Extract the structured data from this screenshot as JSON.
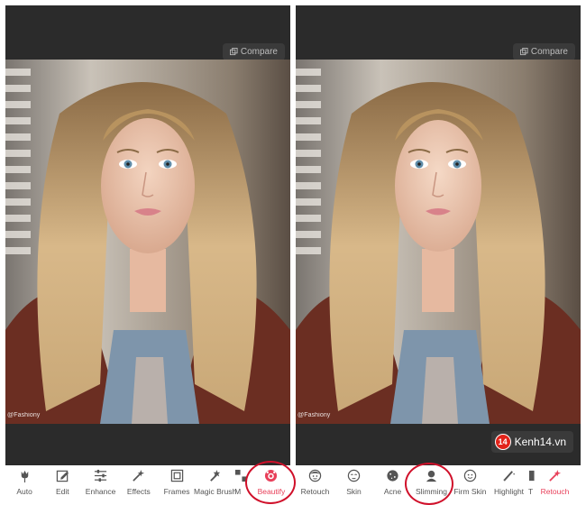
{
  "compare_label": "Compare",
  "watermark": "@Fashiony",
  "site_badge": {
    "logo": "14",
    "text": "Kenh14.vn"
  },
  "left_toolbar": [
    {
      "label": "Auto",
      "icon": "tulip-icon"
    },
    {
      "label": "Edit",
      "icon": "edit-icon"
    },
    {
      "label": "Enhance",
      "icon": "sliders-icon"
    },
    {
      "label": "Effects",
      "icon": "magic-wand-icon"
    },
    {
      "label": "Frames",
      "icon": "frame-icon"
    },
    {
      "label": "Magic Brush",
      "icon": "magic-brush-icon"
    },
    {
      "label": "M",
      "icon": "mosaic-icon"
    },
    {
      "label": "Beautify",
      "icon": "beautify-face-icon",
      "active": true
    }
  ],
  "right_toolbar": [
    {
      "label": "Retouch",
      "icon": "face-retouch-icon"
    },
    {
      "label": "Skin",
      "icon": "skin-icon"
    },
    {
      "label": "Acne",
      "icon": "acne-icon"
    },
    {
      "label": "Slimming",
      "icon": "slimming-icon"
    },
    {
      "label": "Firm Skin",
      "icon": "firm-skin-icon"
    },
    {
      "label": "Highlight",
      "icon": "highlight-brush-icon"
    },
    {
      "label": "T",
      "icon": "tool-icon"
    },
    {
      "label": "Retouch",
      "icon": "retouch-wand-icon",
      "active": true
    }
  ],
  "colors": {
    "accent": "#e8405a",
    "highlight_circle": "#d0102a",
    "panel_bg": "#2b2b2b"
  }
}
